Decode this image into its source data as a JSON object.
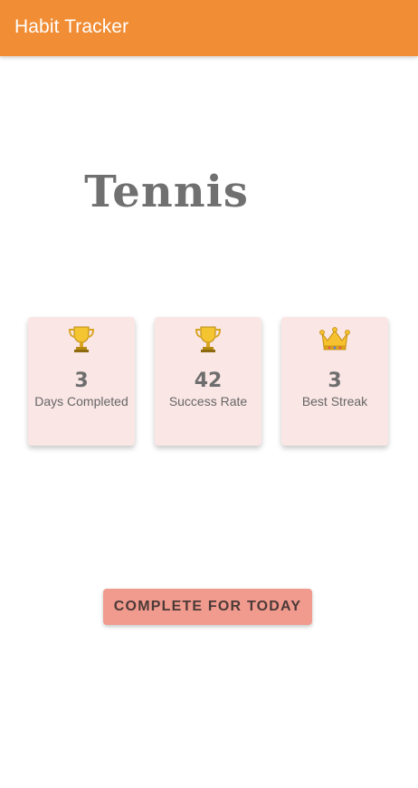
{
  "app_bar": {
    "title": "Habit Tracker",
    "color": "#f18d35"
  },
  "habit": {
    "name": "Tennis"
  },
  "stats": [
    {
      "icon": "trophy-icon",
      "value": "3",
      "label": "Days Completed"
    },
    {
      "icon": "trophy-icon",
      "value": "42",
      "label": "Success Rate"
    },
    {
      "icon": "crown-icon",
      "value": "3",
      "label": "Best Streak"
    }
  ],
  "actions": {
    "complete_label": "COMPLETE FOR TODAY",
    "button_color": "#f19a8e"
  },
  "colors": {
    "card_background": "#fae6e5"
  }
}
